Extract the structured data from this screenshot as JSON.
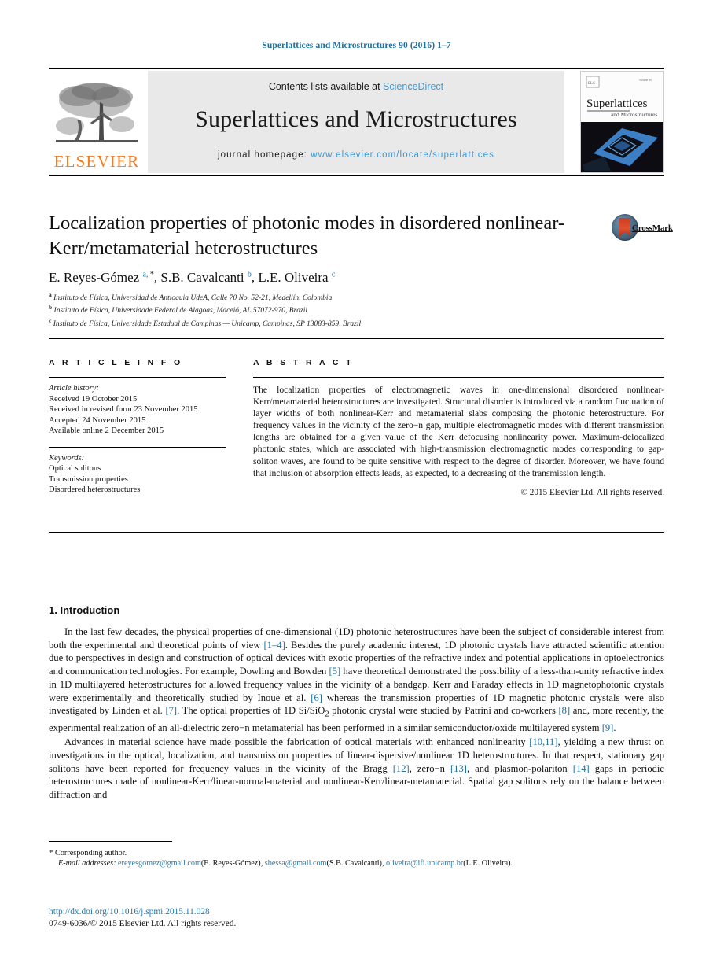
{
  "running_head": "Superlattices and Microstructures 90 (2016) 1–7",
  "masthead": {
    "contents_prefix": "Contents lists available at ",
    "contents_link": "ScienceDirect",
    "journal_name": "Superlattices and Microstructures",
    "homepage_prefix": "journal homepage: ",
    "homepage_url": "www.elsevier.com/locate/superlattices",
    "publisher": "ELSEVIER",
    "cover_title_main": "Superlattices",
    "cover_title_sub": "and Microstructures"
  },
  "article": {
    "title": "Localization properties of photonic modes in disordered nonlinear-Kerr/metamaterial heterostructures",
    "crossmark_label": "CrossMark",
    "authors_html": "E. Reyes-Gómez <sup>a, *</sup>, S.B. Cavalcanti <sup>b</sup>, L.E. Oliveira <sup>c</sup>",
    "affiliations": [
      {
        "mark": "a",
        "text": "Instituto de Física, Universidad de Antioquia UdeA, Calle 70 No. 52-21, Medellín, Colombia"
      },
      {
        "mark": "b",
        "text": "Instituto de Física, Universidade Federal de Alagoas, Maceió, AL 57072-970, Brazil"
      },
      {
        "mark": "c",
        "text": "Instituto de Física, Universidade Estadual de Campinas — Unicamp, Campinas, SP 13083-859, Brazil"
      }
    ]
  },
  "article_info": {
    "heading": "A R T I C L E   I N F O",
    "history_label": "Article history:",
    "history": [
      "Received 19 October 2015",
      "Received in revised form 23 November 2015",
      "Accepted 24 November 2015",
      "Available online 2 December 2015"
    ],
    "keywords_label": "Keywords:",
    "keywords": [
      "Optical solitons",
      "Transmission properties",
      "Disordered heterostructures"
    ]
  },
  "abstract": {
    "heading": "A B S T R A C T",
    "text": "The localization properties of electromagnetic waves in one-dimensional disordered nonlinear-Kerr/metamaterial heterostructures are investigated. Structural disorder is introduced via a random fluctuation of layer widths of both nonlinear-Kerr and metamaterial slabs composing the photonic heterostructure. For frequency values in the vicinity of the zero−n gap, multiple electromagnetic modes with different transmission lengths are obtained for a given value of the Kerr defocusing nonlinearity power. Maximum-delocalized photonic states, which are associated with high-transmission electromagnetic modes corresponding to gap-soliton waves, are found to be quite sensitive with respect to the degree of disorder. Moreover, we have found that inclusion of absorption effects leads, as expected, to a decreasing of the transmission length.",
    "copyright": "© 2015 Elsevier Ltd. All rights reserved."
  },
  "body": {
    "section_number_title": "1. Introduction",
    "paragraph_1_parts": [
      "In the last few decades, the physical properties of one-dimensional (1D) photonic heterostructures have been the subject of considerable interest from both the experimental and theoretical points of view ",
      "[1–4]",
      ". Besides the purely academic interest, 1D photonic crystals have attracted scientific attention due to perspectives in design and construction of optical devices with exotic properties of the refractive index and potential applications in optoelectronics and communication technologies. For example, Dowling and Bowden ",
      "[5]",
      " have theoretical demonstrated the possibility of a less-than-unity refractive index in 1D multilayered heterostructures for allowed frequency values in the vicinity of a bandgap. Kerr and Faraday effects in 1D magnetophotonic crystals were experimentally and theoretically studied by Inoue et al. ",
      "[6]",
      " whereas the transmission properties of 1D magnetic photonic crystals were also investigated by Linden et al. ",
      "[7]",
      ". The optical properties of 1D Si/SiO",
      "2",
      " photonic crystal were studied by Patrini and co-workers ",
      "[8]",
      " and, more recently, the experimental realization of an all-dielectric zero−n metamaterial has been performed in a similar semiconductor/oxide multilayered system ",
      "[9]",
      "."
    ],
    "paragraph_2_parts": [
      "Advances in material science have made possible the fabrication of optical materials with enhanced nonlinearity ",
      "[10,11]",
      ", yielding a new thrust on investigations in the optical, localization, and transmission properties of linear-dispersive/nonlinear 1D heterostructures. In that respect, stationary gap solitons have been reported for frequency values in the vicinity of the Bragg ",
      "[12]",
      ", zero−n ",
      "[13]",
      ", and plasmon-polariton ",
      "[14]",
      " gaps in periodic heterostructures made of nonlinear-Kerr/linear-normal-material and nonlinear-Kerr/linear-metamaterial. Spatial gap solitons rely on the balance between diffraction and"
    ]
  },
  "footnote": {
    "corresponding": "Corresponding author.",
    "email_label": "E-mail addresses:",
    "emails": [
      {
        "address": "ereyesgomez@gmail.com",
        "owner": "(E. Reyes-Gómez)"
      },
      {
        "address": "sbessa@gmail.com",
        "owner": "(S.B. Cavalcanti)"
      },
      {
        "address": "oliveira@ifi.unicamp.br",
        "owner": "(L.E. Oliveira)"
      }
    ]
  },
  "doi": {
    "url": "http://dx.doi.org/10.1016/j.spmi.2015.11.028",
    "issn_line": "0749-6036/© 2015 Elsevier Ltd. All rights reserved."
  },
  "colors": {
    "link_blue": "#1f7bb0",
    "running_head_blue": "#1f6f9e",
    "elsevier_orange": "#f47c20",
    "panel_grey": "#e9e9e9"
  }
}
